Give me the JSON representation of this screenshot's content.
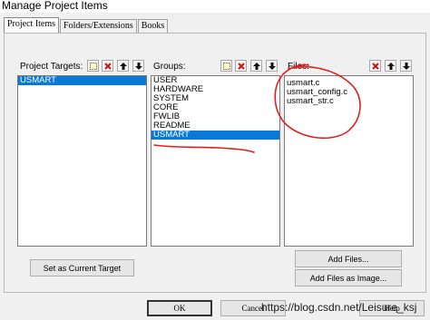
{
  "window": {
    "title": "Manage Project Items"
  },
  "tabs": [
    {
      "label": "Project Items",
      "active": true
    },
    {
      "label": "Folders/Extensions",
      "active": false
    },
    {
      "label": "Books",
      "active": false
    }
  ],
  "targets": {
    "label": "Project Targets:",
    "items": [
      "USMART"
    ],
    "selected_index": 0,
    "set_current_label": "Set as Current Target"
  },
  "groups": {
    "label": "Groups:",
    "items": [
      "USER",
      "HARDWARE",
      "SYSTEM",
      "CORE",
      "FWLIB",
      "README",
      "USMART"
    ],
    "selected_index": 6
  },
  "files": {
    "label": "Files:",
    "items": [
      "usmart.c",
      "usmart_config.c",
      "usmart_str.c"
    ],
    "add_files_label": "Add Files...",
    "add_files_image_label": "Add Files as Image..."
  },
  "footer": {
    "ok_label": "OK",
    "cancel_label": "Cancel",
    "help_label": "Help"
  },
  "watermark": "https://blog.csdn.net/Leisure_ksj",
  "colors": {
    "selection": "#0a78d7",
    "annotation": "#e02020"
  },
  "toolbar_icons": [
    "new-icon",
    "delete-icon",
    "move-up-icon",
    "move-down-icon"
  ]
}
